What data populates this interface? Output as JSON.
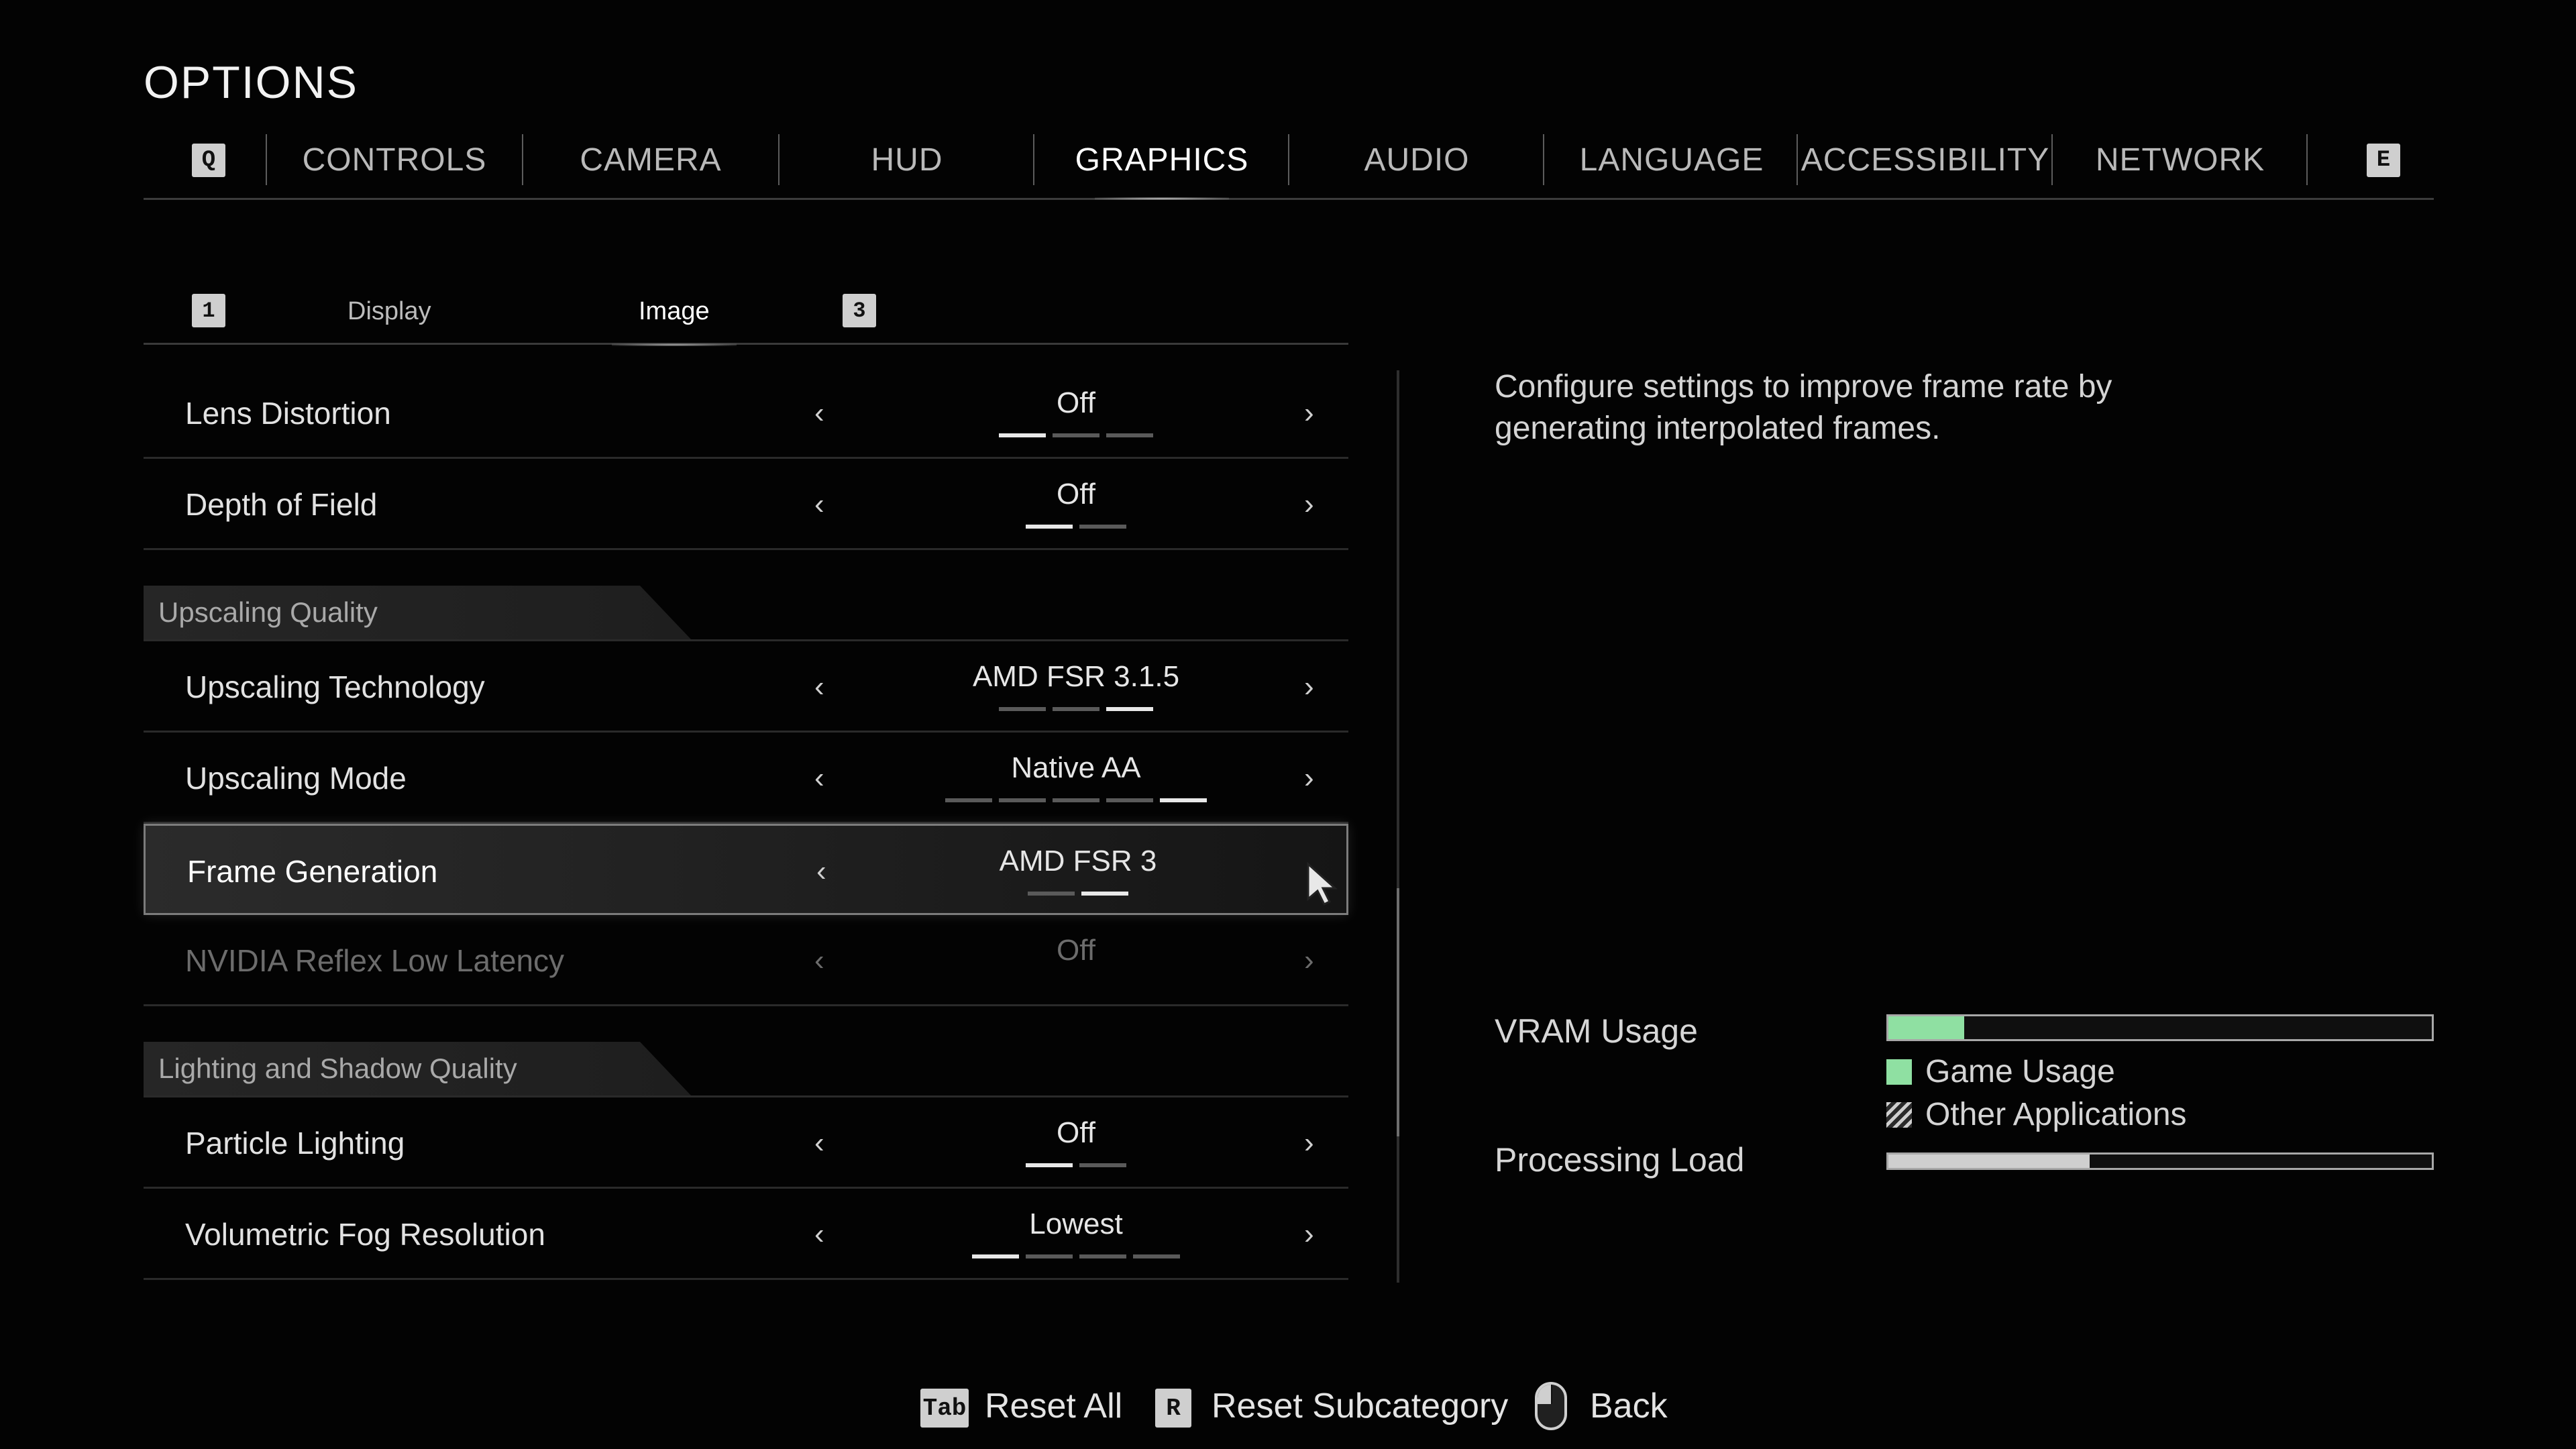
{
  "page": {
    "title": "OPTIONS"
  },
  "top_tabs": {
    "prev_key": "Q",
    "next_key": "E",
    "items": [
      {
        "label": "CONTROLS",
        "active": false
      },
      {
        "label": "CAMERA",
        "active": false
      },
      {
        "label": "HUD",
        "active": false
      },
      {
        "label": "GRAPHICS",
        "active": true
      },
      {
        "label": "AUDIO",
        "active": false
      },
      {
        "label": "LANGUAGE",
        "active": false
      },
      {
        "label": "ACCESSIBILITY",
        "active": false
      },
      {
        "label": "NETWORK",
        "active": false
      }
    ]
  },
  "sub_tabs": {
    "prev_key": "1",
    "next_key": "3",
    "items": [
      {
        "label": "Display",
        "active": false
      },
      {
        "label": "Image",
        "active": true
      }
    ]
  },
  "settings": {
    "rows": [
      {
        "label": "Lens Distortion",
        "value": "Off",
        "options_count": 3,
        "selected_index": 0
      },
      {
        "label": "Depth of Field",
        "value": "Off",
        "options_count": 2,
        "selected_index": 0
      },
      {
        "section": "Upscaling Quality"
      },
      {
        "label": "Upscaling Technology",
        "value": "AMD FSR 3.1.5",
        "options_count": 3,
        "selected_index": 2
      },
      {
        "label": "Upscaling Mode",
        "value": "Native AA",
        "options_count": 5,
        "selected_index": 4
      },
      {
        "label": "Frame Generation",
        "value": "AMD FSR 3",
        "options_count": 2,
        "selected_index": 1,
        "highlighted": true
      },
      {
        "label": "NVIDIA Reflex Low Latency",
        "value": "Off",
        "disabled": true
      },
      {
        "section": "Lighting and Shadow Quality"
      },
      {
        "label": "Particle Lighting",
        "value": "Off",
        "options_count": 2,
        "selected_index": 0
      },
      {
        "label": "Volumetric Fog Resolution",
        "value": "Lowest",
        "options_count": 4,
        "selected_index": 0
      }
    ],
    "left_arrow": "‹",
    "right_arrow": "›"
  },
  "description": {
    "text": "Configure settings to improve frame rate by generating interpolated frames."
  },
  "usage": {
    "vram_label": "VRAM Usage",
    "vram_game_fraction": 0.14,
    "legend_game": "Game Usage",
    "legend_other": "Other Applications",
    "processing_label": "Processing Load",
    "processing_fraction": 0.37,
    "colors": {
      "game": "#8fe0a2",
      "processing": "#cfcfcf"
    }
  },
  "footer": {
    "reset_all_key": "Tab",
    "reset_all_label": "Reset All",
    "reset_sub_key": "R",
    "reset_sub_label": "Reset Subcategory",
    "back_label": "Back"
  }
}
